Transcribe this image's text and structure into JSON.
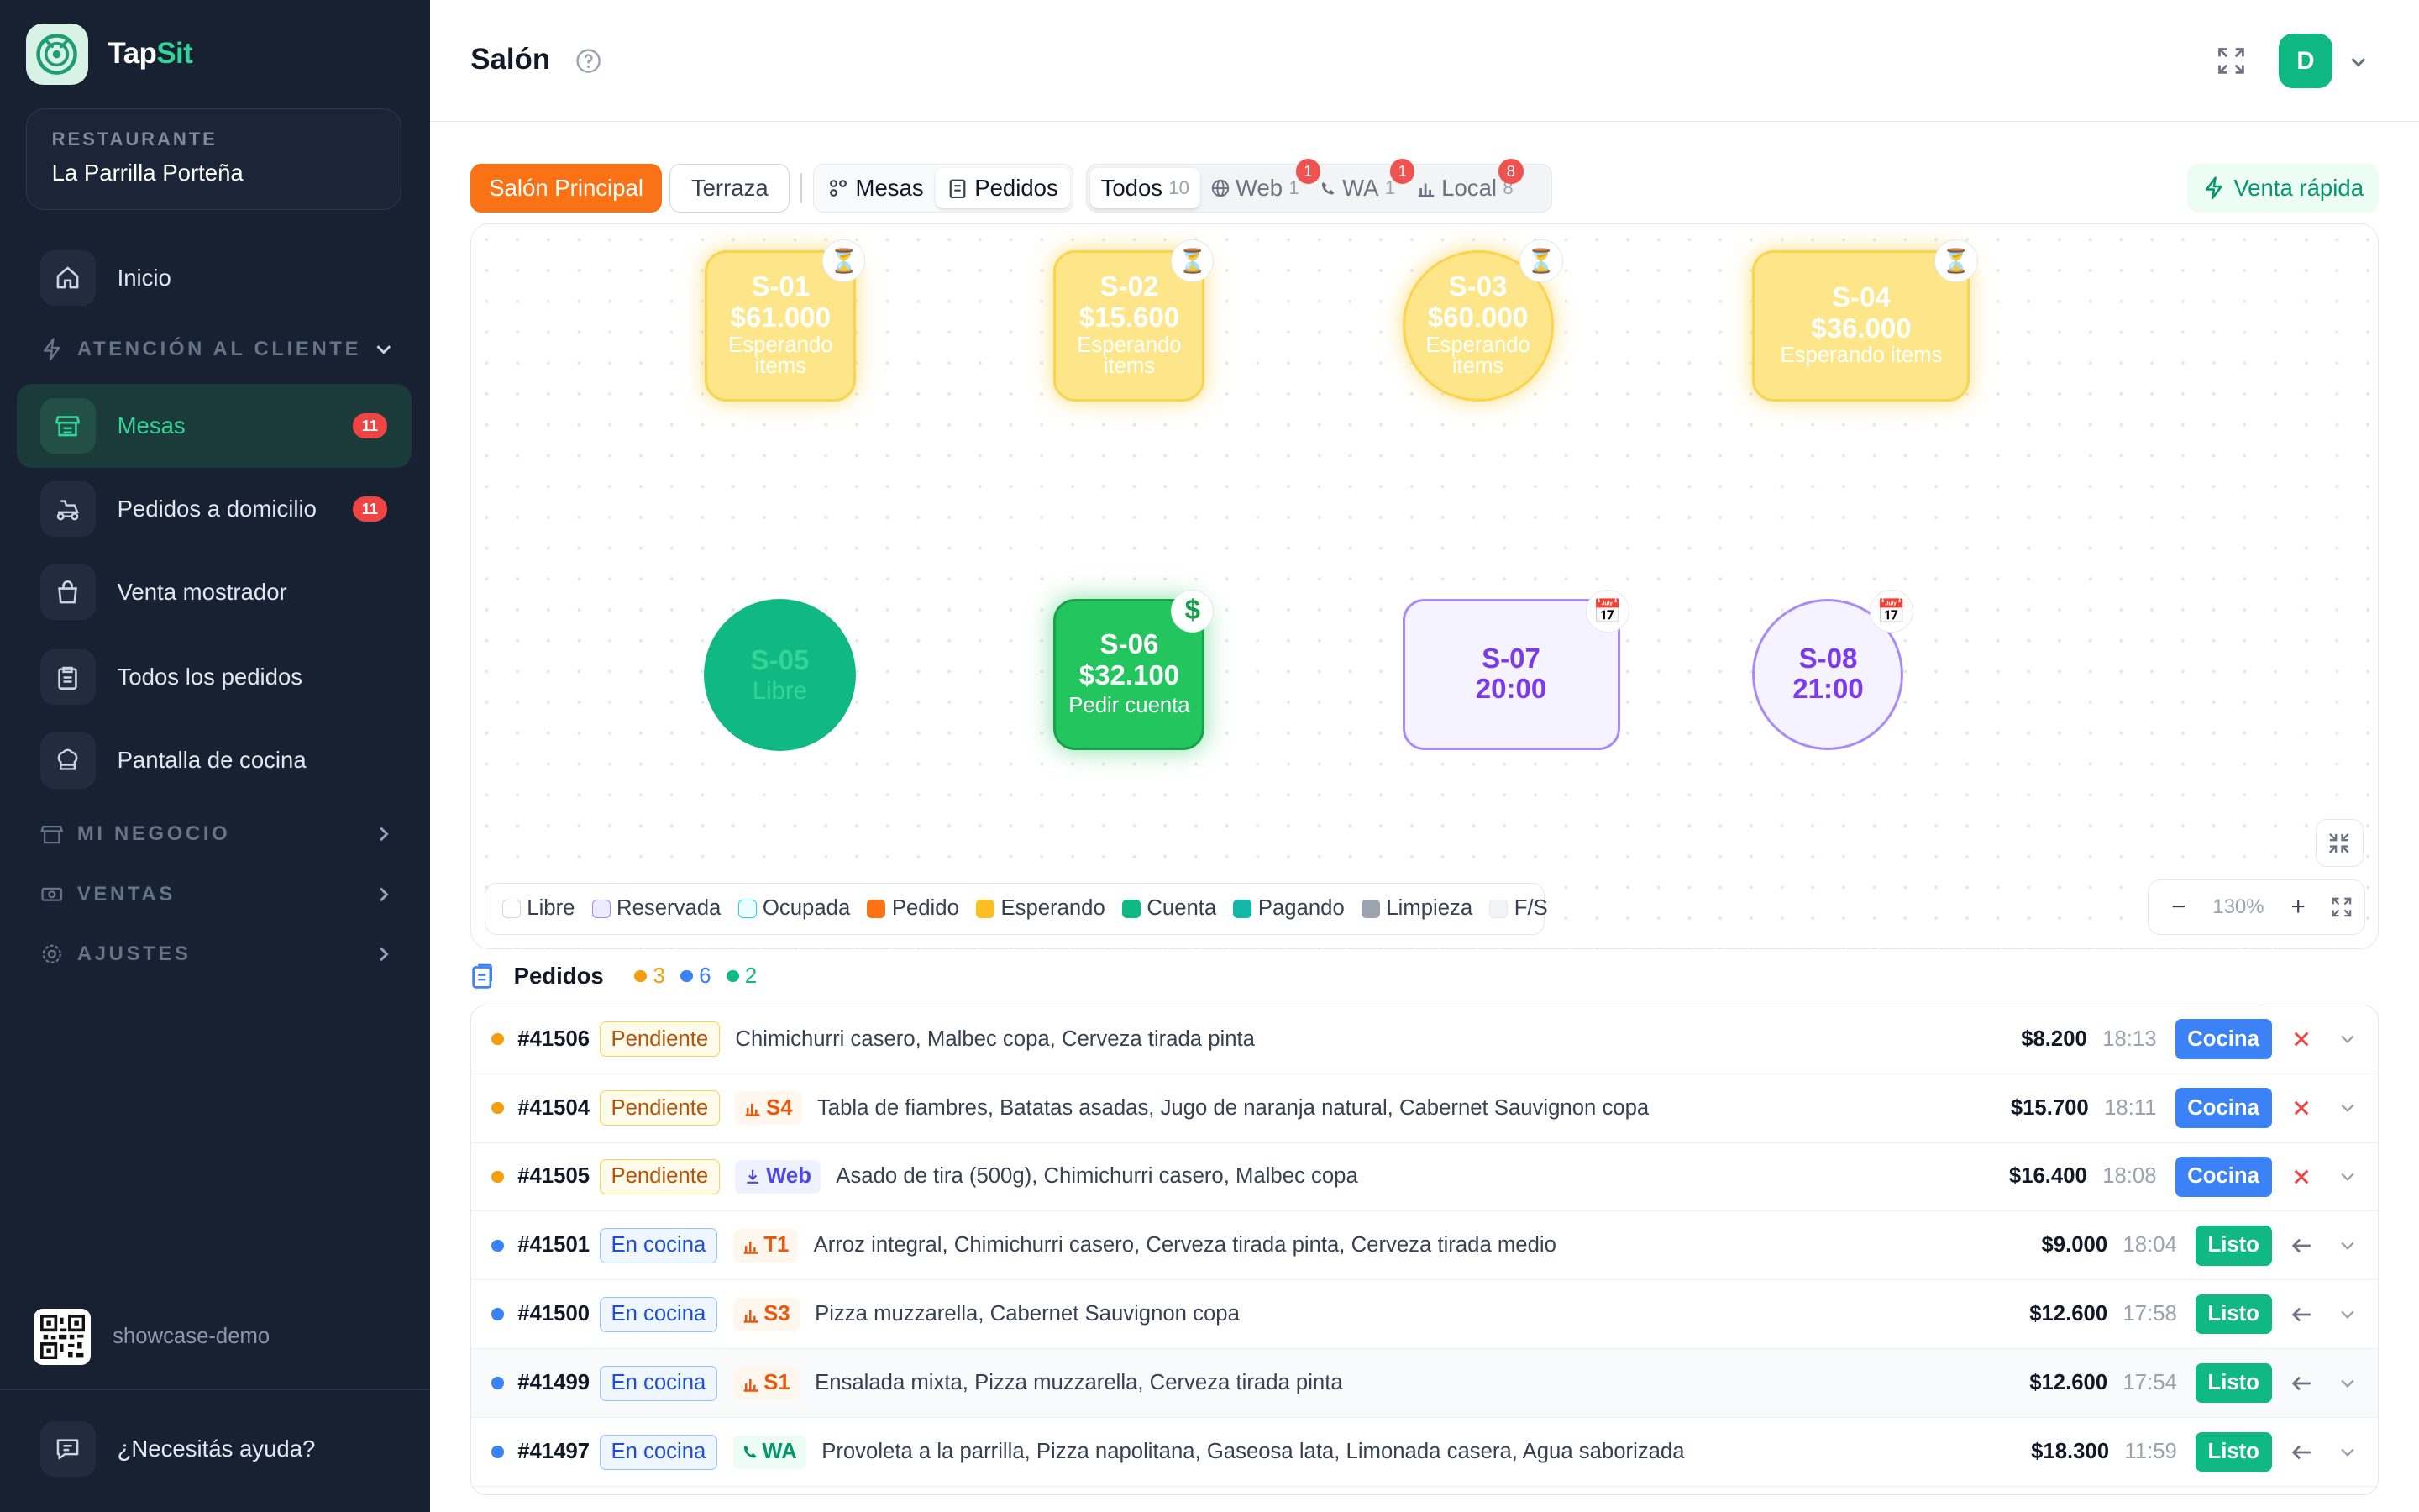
{
  "brand": {
    "name_a": "Tap",
    "name_b": "Sit"
  },
  "restaurant": {
    "label": "RESTAURANTE",
    "name": "La Parrilla Porteña"
  },
  "nav": {
    "inicio": "Inicio",
    "section_atencion": "ATENCIÓN AL CLIENTE",
    "mesas": "Mesas",
    "mesas_badge": "11",
    "pedidos_domicilio": "Pedidos a domicilio",
    "pedidos_domicilio_badge": "11",
    "venta_mostrador": "Venta mostrador",
    "todos_pedidos": "Todos los pedidos",
    "pantalla_cocina": "Pantalla de cocina",
    "section_negocio": "MI NEGOCIO",
    "section_ventas": "VENTAS",
    "section_ajustes": "AJUSTES"
  },
  "workspace": "showcase-demo",
  "help": "¿Necesitás ayuda?",
  "header": {
    "title": "Salón",
    "avatar": "D"
  },
  "toolbar": {
    "salon_principal": "Salón Principal",
    "terraza": "Terraza",
    "mesas": "Mesas",
    "pedidos": "Pedidos",
    "filters": [
      {
        "label": "Todos",
        "count": "10",
        "badge": ""
      },
      {
        "label": "Web",
        "count": "1",
        "badge": "1"
      },
      {
        "label": "WA",
        "count": "1",
        "badge": "1"
      },
      {
        "label": "Local",
        "count": "8",
        "badge": "8"
      }
    ],
    "venta_rapida": "Venta rápida"
  },
  "tables": [
    {
      "id": "S-01",
      "amount": "$61.000",
      "status": "Esperando items",
      "state": "esperando"
    },
    {
      "id": "S-02",
      "amount": "$15.600",
      "status": "Esperando items",
      "state": "esperando"
    },
    {
      "id": "S-03",
      "amount": "$60.000",
      "status": "Esperando items",
      "state": "esperando"
    },
    {
      "id": "S-04",
      "amount": "$36.000",
      "status": "Esperando items",
      "state": "esperando"
    },
    {
      "id": "S-05",
      "status": "Libre",
      "state": "libre"
    },
    {
      "id": "S-06",
      "amount": "$32.100",
      "status": "Pedir cuenta",
      "state": "cuenta"
    },
    {
      "id": "S-07",
      "time": "20:00",
      "state": "reservada"
    },
    {
      "id": "S-08",
      "time": "21:00",
      "state": "reservada"
    }
  ],
  "legend": [
    {
      "label": "Libre",
      "color": "#ffffff"
    },
    {
      "label": "Reservada",
      "color": "#ede9fe"
    },
    {
      "label": "Ocupada",
      "color": "#ecfeff"
    },
    {
      "label": "Pedido",
      "color": "#f97316"
    },
    {
      "label": "Esperando",
      "color": "#fbbf24"
    },
    {
      "label": "Cuenta",
      "color": "#10b981"
    },
    {
      "label": "Pagando",
      "color": "#14b8a6"
    },
    {
      "label": "Limpieza",
      "color": "#9ca3af"
    },
    {
      "label": "F/S",
      "color": "#f3f4f6"
    }
  ],
  "zoom": {
    "level": "130%",
    "minus": "−",
    "plus": "+"
  },
  "pedidos": {
    "title": "Pedidos",
    "counts": [
      {
        "value": "3",
        "color": "#f59e0b"
      },
      {
        "value": "6",
        "color": "#3b82f6"
      },
      {
        "value": "2",
        "color": "#10b981"
      }
    ],
    "rows": [
      {
        "num": "#41506",
        "status": "Pendiente",
        "source": "",
        "items": "Chimichurri casero, Malbec copa, Cerveza tirada pinta",
        "amount": "$8.200",
        "time": "18:13",
        "action": "Cocina"
      },
      {
        "num": "#41504",
        "status": "Pendiente",
        "source": "S4",
        "items": "Tabla de fiambres, Batatas asadas, Jugo de naranja natural, Cabernet Sauvignon copa",
        "amount": "$15.700",
        "time": "18:11",
        "action": "Cocina"
      },
      {
        "num": "#41505",
        "status": "Pendiente",
        "source": "Web",
        "items": "Asado de tira (500g), Chimichurri casero, Malbec copa",
        "amount": "$16.400",
        "time": "18:08",
        "action": "Cocina"
      },
      {
        "num": "#41501",
        "status": "En cocina",
        "source": "T1",
        "items": "Arroz integral, Chimichurri casero, Cerveza tirada pinta, Cerveza tirada medio",
        "amount": "$9.000",
        "time": "18:04",
        "action": "Listo"
      },
      {
        "num": "#41500",
        "status": "En cocina",
        "source": "S3",
        "items": "Pizza muzzarella, Cabernet Sauvignon copa",
        "amount": "$12.600",
        "time": "17:58",
        "action": "Listo"
      },
      {
        "num": "#41499",
        "status": "En cocina",
        "source": "S1",
        "items": "Ensalada mixta, Pizza muzzarella, Cerveza tirada pinta",
        "amount": "$12.600",
        "time": "17:54",
        "action": "Listo"
      },
      {
        "num": "#41497",
        "status": "En cocina",
        "source": "WA",
        "items": "Provoleta a la parrilla, Pizza napolitana, Gaseosa lata, Limonada casera, Agua saborizada",
        "amount": "$18.300",
        "time": "11:59",
        "action": "Listo"
      }
    ]
  }
}
